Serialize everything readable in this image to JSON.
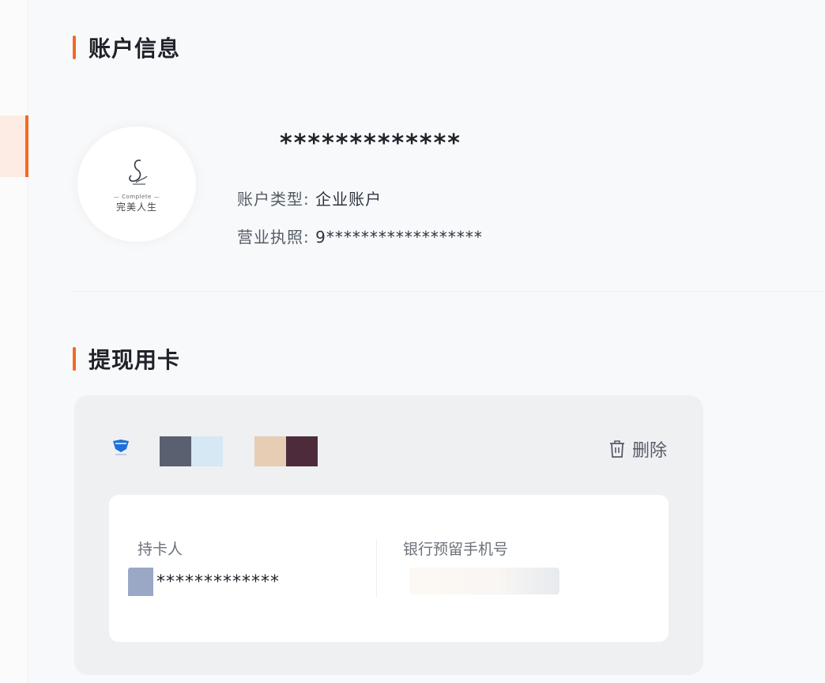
{
  "account_section": {
    "title": "账户信息",
    "avatar_logo": {
      "small": "— Complete —",
      "main": "完美人生"
    },
    "account_name": "*************",
    "type_label": "账户类型:",
    "type_value": "企业账户",
    "license_label": "营业执照:",
    "license_value": "9******************"
  },
  "withdraw_section": {
    "title": "提现用卡",
    "delete_label": "删除",
    "holder_label": "持卡人",
    "holder_value": "*************",
    "phone_label": "银行预留手机号"
  },
  "colors": {
    "accent": "#f26a21",
    "swatch_1": "#5a6070",
    "swatch_2": "#d5e8f3",
    "swatch_3": "#e6cdb3",
    "swatch_4": "#4d2b3a"
  },
  "icons": {
    "bank": "bank-logo-icon",
    "delete": "trash-icon"
  }
}
